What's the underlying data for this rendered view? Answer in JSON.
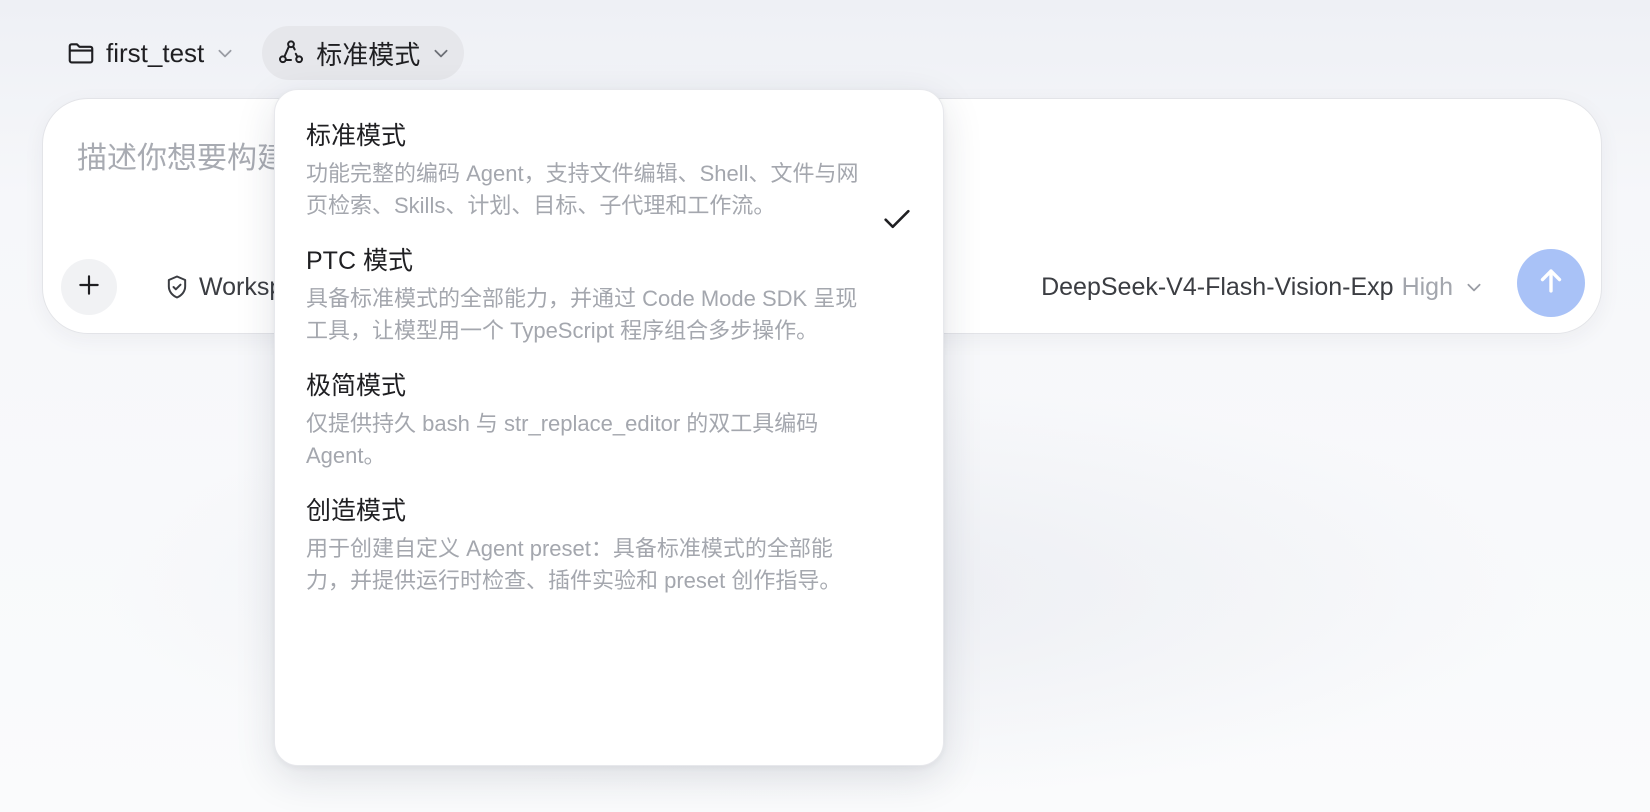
{
  "topbar": {
    "project_label": "first_test",
    "mode_label": "标准模式"
  },
  "composer": {
    "placeholder": "描述你想要构建",
    "workspace_label": "Workspace",
    "model_name": "DeepSeek-V4-Flash-Vision-Exp",
    "effort": "High"
  },
  "mode_menu": {
    "selected": "标准模式",
    "options": [
      {
        "title": "标准模式",
        "description": "功能完整的编码 Agent，支持文件编辑、Shell、文件与网页检索、Skills、计划、目标、子代理和工作流。"
      },
      {
        "title": "PTC 模式",
        "description": "具备标准模式的全部能力，并通过 Code Mode SDK 呈现工具，让模型用一个 TypeScript 程序组合多步操作。"
      },
      {
        "title": "极简模式",
        "description": "仅提供持久 bash 与 str_replace_editor 的双工具编码 Agent。"
      },
      {
        "title": "创造模式",
        "description": "用于创建自定义 Agent preset：具备标准模式的全部能力，并提供运行时检查、插件实验和 preset 创作指导。"
      }
    ]
  },
  "colors": {
    "send_button": "#a9c2f7",
    "active_pill": "#e6e7eb",
    "muted_text": "#a4a7ae"
  },
  "icons": {
    "project": "folder-icon",
    "mode": "agent-nodes-icon",
    "workspace": "shield-check-icon",
    "attach": "plus-icon",
    "send": "arrow-up-icon",
    "selected": "checkmark-icon"
  }
}
